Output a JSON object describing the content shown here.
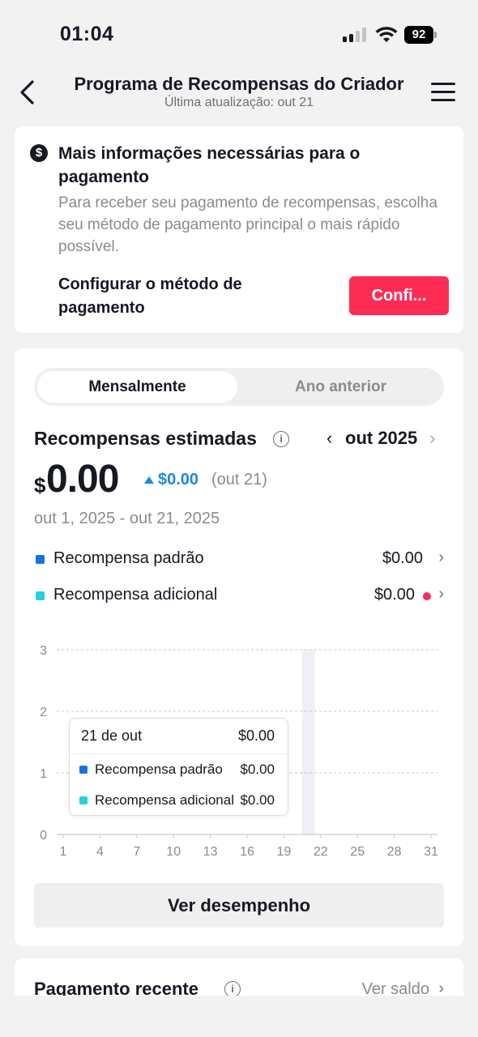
{
  "status_bar": {
    "time": "01:04",
    "battery": "92"
  },
  "header": {
    "title": "Programa de Recompensas do Criador",
    "subtitle": "Última atualização: out 21"
  },
  "payment_notice": {
    "title": "Mais informações necessárias para o pagamento",
    "description": "Para receber seu pagamento de recompensas, escolha seu método de pagamento principal o mais rápido possível.",
    "config_label": "Configurar o método de pagamento",
    "config_button": "Confi..."
  },
  "tabs": [
    {
      "label": "Mensalmente",
      "active": true
    },
    {
      "label": "Ano anterior",
      "active": false
    }
  ],
  "rewards": {
    "title": "Recompensas estimadas",
    "month": "out 2025",
    "currency_symbol": "$",
    "amount": "0.00",
    "delta_value": "$0.00",
    "delta_date": "(out 21)",
    "date_range": "out 1, 2025 - out 21, 2025",
    "legend": [
      {
        "label": "Recompensa padrão",
        "value": "$0.00",
        "color": "#1a73d9",
        "alert": false
      },
      {
        "label": "Recompensa adicional",
        "value": "$0.00",
        "color": "#25d0e0",
        "alert": true
      }
    ],
    "tooltip": {
      "date": "21 de out",
      "total": "$0.00",
      "rows": [
        {
          "label": "Recompensa padrão",
          "value": "$0.00"
        },
        {
          "label": "Recompensa adicional",
          "value": "$0.00"
        }
      ]
    },
    "performance_button": "Ver desempenho"
  },
  "chart_data": {
    "type": "bar",
    "x_ticks": [
      1,
      4,
      7,
      10,
      13,
      16,
      19,
      22,
      25,
      28,
      31
    ],
    "y_ticks": [
      0,
      1,
      2,
      3
    ],
    "ylim": [
      0,
      3
    ],
    "xlim": [
      1,
      31
    ],
    "highlighted_day": 21,
    "series": [
      {
        "name": "Recompensa padrão",
        "color": "#1a73d9",
        "values": [
          0,
          0,
          0,
          0,
          0,
          0,
          0,
          0,
          0,
          0,
          0,
          0,
          0,
          0,
          0,
          0,
          0,
          0,
          0,
          0,
          0
        ]
      },
      {
        "name": "Recompensa adicional",
        "color": "#25d0e0",
        "values": [
          0,
          0,
          0,
          0,
          0,
          0,
          0,
          0,
          0,
          0,
          0,
          0,
          0,
          0,
          0,
          0,
          0,
          0,
          0,
          0,
          0
        ]
      }
    ],
    "grid": true
  },
  "recent_payment": {
    "title": "Pagamento recente",
    "link": "Ver saldo"
  },
  "colors": {
    "accent": "#fe2c55",
    "delta": "#1e88e5"
  }
}
